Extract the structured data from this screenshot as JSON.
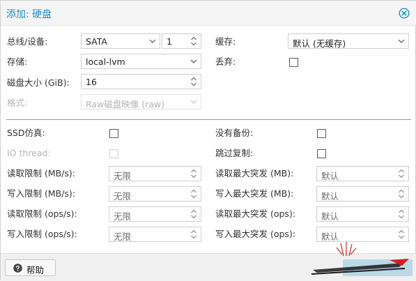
{
  "dialog": {
    "title": "添加: 硬盘"
  },
  "form": {
    "bus_device": {
      "label": "总线/设备:",
      "bus_value": "SATA",
      "device_value": "1"
    },
    "storage": {
      "label": "存储:",
      "value": "local-lvm"
    },
    "disk_size": {
      "label": "磁盘大小 (GiB):",
      "value": "16"
    },
    "format": {
      "label": "格式:",
      "value": "Raw磁盘映像 (raw)"
    },
    "cache": {
      "label": "缓存:",
      "value": "默认 (无缓存)"
    },
    "discard": {
      "label": "丢弃:",
      "checked": false
    },
    "ssd_emulation": {
      "label": "SSD仿真:",
      "checked": false
    },
    "io_thread": {
      "label": "IO thread:",
      "checked": false
    },
    "no_backup": {
      "label": "没有备份:",
      "checked": false
    },
    "skip_replication": {
      "label": "跳过复制:",
      "checked": false
    },
    "read_limit_mbs": {
      "label": "读取限制 (MB/s):",
      "placeholder": "无限"
    },
    "write_limit_mbs": {
      "label": "写入限制 (MB/s):",
      "placeholder": "无限"
    },
    "read_limit_ops": {
      "label": "读取限制 (ops/s):",
      "placeholder": "无限"
    },
    "write_limit_ops": {
      "label": "写入限制 (ops/s):",
      "placeholder": "无限"
    },
    "read_burst_mb": {
      "label": "读取最大突发 (MB):",
      "placeholder": "默认"
    },
    "write_burst_mb": {
      "label": "写入最大突发 (MB):",
      "placeholder": "默认"
    },
    "read_burst_ops": {
      "label": "读取最大突发 (ops):",
      "placeholder": "默认"
    },
    "write_burst_ops": {
      "label": "写入最大突发 (ops):",
      "placeholder": "默认"
    }
  },
  "footer": {
    "help_label": "帮助"
  },
  "colors": {
    "accent": "#1d8fc9",
    "disabled_text": "#b4b4b4"
  }
}
